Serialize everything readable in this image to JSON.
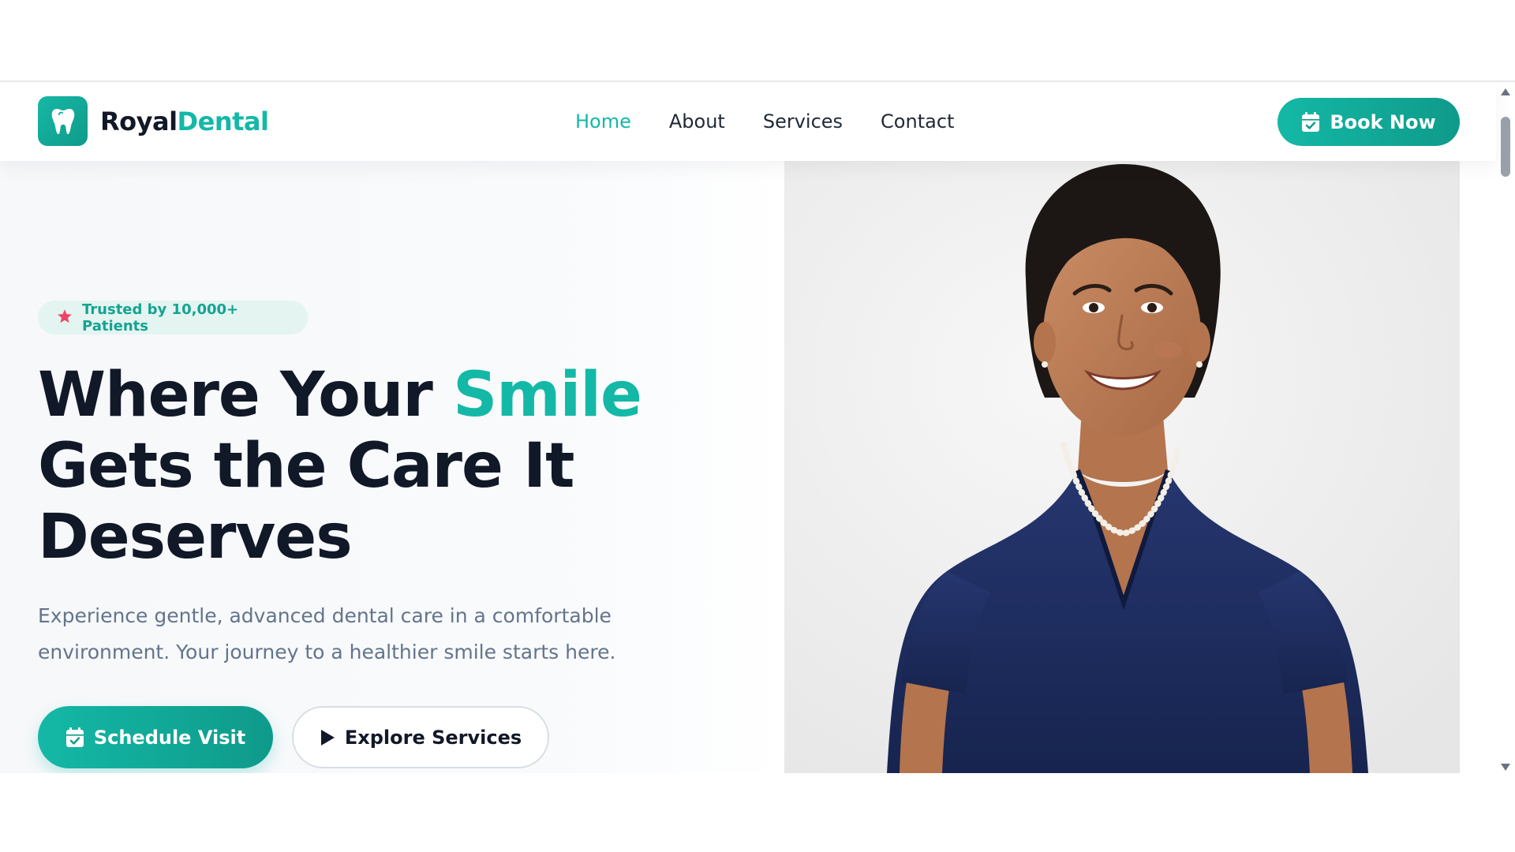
{
  "brand": {
    "name_part1": "Royal",
    "name_part2": "Dental",
    "icon": "tooth-icon"
  },
  "nav": {
    "items": [
      {
        "label": "Home",
        "active": true
      },
      {
        "label": "About",
        "active": false
      },
      {
        "label": "Services",
        "active": false
      },
      {
        "label": "Contact",
        "active": false
      }
    ],
    "cta_label": "Book Now",
    "cta_icon": "calendar-check-icon"
  },
  "hero": {
    "badge_icon": "star-icon",
    "badge_text": "Trusted by 10,000+ Patients",
    "headline_part1": "Where Your ",
    "headline_accent": "Smile",
    "headline_line2": "Gets the Care It",
    "headline_line3": "Deserves",
    "subtext_line1": "Experience gentle, advanced dental care in a comfortable",
    "subtext_line2": "environment. Your journey to a healthier smile starts here.",
    "primary_button": {
      "label": "Schedule Visit",
      "icon": "calendar-check-icon"
    },
    "secondary_button": {
      "label": "Explore Services",
      "icon": "play-icon"
    }
  },
  "colors": {
    "accent": "#14b8a6",
    "accent_dark": "#0f9a8a",
    "heading": "#111827",
    "body_text": "#64748b",
    "badge_bg": "#e4f4f1",
    "star": "#ef4466",
    "scrub_blue": "#1e2d63"
  }
}
